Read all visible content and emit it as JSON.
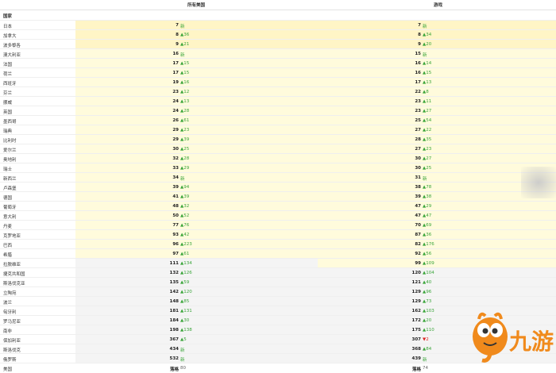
{
  "header": {
    "col1": "所有美国",
    "col2": "游戏"
  },
  "section": "国家",
  "rows": [
    {
      "name": "日本",
      "r1": "7",
      "c1": "新",
      "r2": "7",
      "c2": "新"
    },
    {
      "name": "加拿大",
      "r1": "8",
      "c1": "▲36",
      "r2": "8",
      "c2": "▲34"
    },
    {
      "name": "波多黎各",
      "r1": "9",
      "c1": "▲21",
      "r2": "9",
      "c2": "▲20"
    },
    {
      "name": "澳大利亚",
      "r1": "16",
      "c1": "新",
      "r2": "15",
      "c2": "新"
    },
    {
      "name": "法国",
      "r1": "17",
      "c1": "▲15",
      "r2": "16",
      "c2": "▲14"
    },
    {
      "name": "荷兰",
      "r1": "17",
      "c1": "▲15",
      "r2": "16",
      "c2": "▲15"
    },
    {
      "name": "西班牙",
      "r1": "19",
      "c1": "▲16",
      "r2": "17",
      "c2": "▲13"
    },
    {
      "name": "芬兰",
      "r1": "23",
      "c1": "▲12",
      "r2": "22",
      "c2": "▲8"
    },
    {
      "name": "挪威",
      "r1": "24",
      "c1": "▲13",
      "r2": "23",
      "c2": "▲11"
    },
    {
      "name": "英国",
      "r1": "24",
      "c1": "▲28",
      "r2": "23",
      "c2": "▲27"
    },
    {
      "name": "墨西哥",
      "r1": "26",
      "c1": "▲61",
      "r2": "25",
      "c2": "▲54"
    },
    {
      "name": "瑞典",
      "r1": "29",
      "c1": "▲23",
      "r2": "27",
      "c2": "▲22"
    },
    {
      "name": "比利时",
      "r1": "29",
      "c1": "▲39",
      "r2": "28",
      "c2": "▲35"
    },
    {
      "name": "爱尔兰",
      "r1": "30",
      "c1": "▲25",
      "r2": "27",
      "c2": "▲23"
    },
    {
      "name": "奥地利",
      "r1": "32",
      "c1": "▲28",
      "r2": "30",
      "c2": "▲27"
    },
    {
      "name": "瑞士",
      "r1": "33",
      "c1": "▲29",
      "r2": "30",
      "c2": "▲25"
    },
    {
      "name": "新西兰",
      "r1": "34",
      "c1": "新",
      "r2": "31",
      "c2": "新"
    },
    {
      "name": "卢森堡",
      "r1": "39",
      "c1": "▲94",
      "r2": "38",
      "c2": "▲78"
    },
    {
      "name": "德国",
      "r1": "41",
      "c1": "▲39",
      "r2": "39",
      "c2": "▲38"
    },
    {
      "name": "葡萄牙",
      "r1": "48",
      "c1": "▲32",
      "r2": "47",
      "c2": "▲29"
    },
    {
      "name": "意大利",
      "r1": "50",
      "c1": "▲52",
      "r2": "47",
      "c2": "▲47"
    },
    {
      "name": "丹麦",
      "r1": "77",
      "c1": "▲76",
      "r2": "70",
      "c2": "▲69"
    },
    {
      "name": "克罗地亚",
      "r1": "93",
      "c1": "▲42",
      "r2": "87",
      "c2": "▲36"
    },
    {
      "name": "巴西",
      "r1": "96",
      "c1": "▲223",
      "r2": "82",
      "c2": "▲176"
    },
    {
      "name": "希腊",
      "r1": "97",
      "c1": "▲61",
      "r2": "92",
      "c2": "▲56"
    },
    {
      "name": "拉脱维亚",
      "r1": "111",
      "c1": "▲134",
      "r2": "99",
      "c2": "▲109"
    },
    {
      "name": "捷克共和国",
      "r1": "132",
      "c1": "▲126",
      "r2": "120",
      "c2": "▲104"
    },
    {
      "name": "斯洛伐克亚",
      "r1": "135",
      "c1": "▲59",
      "r2": "121",
      "c2": "▲40"
    },
    {
      "name": "立陶宛",
      "r1": "142",
      "c1": "▲120",
      "r2": "129",
      "c2": "▲96"
    },
    {
      "name": "波兰",
      "r1": "148",
      "c1": "▲85",
      "r2": "129",
      "c2": "▲73"
    },
    {
      "name": "匈牙利",
      "r1": "181",
      "c1": "▲131",
      "r2": "162",
      "c2": "▲103"
    },
    {
      "name": "罗马尼亚",
      "r1": "184",
      "c1": "▲30",
      "r2": "172",
      "c2": "▲20"
    },
    {
      "name": "南非",
      "r1": "198",
      "c1": "▲138",
      "r2": "175",
      "c2": "▲110"
    },
    {
      "name": "保加利亚",
      "r1": "367",
      "c1": "▲5",
      "r2": "307",
      "c2": "▼2"
    },
    {
      "name": "斯洛伐克",
      "r1": "434",
      "c1": "新",
      "r2": "368",
      "c2": "▲84"
    },
    {
      "name": "俄罗斯",
      "r1": "532",
      "c1": "新",
      "r2": "439",
      "c2": "新"
    },
    {
      "name": "美国",
      "r1": "落格",
      "c1": "80",
      "r2": "落格",
      "c2": "74"
    }
  ],
  "logo": {
    "text": "九游",
    "colors": {
      "orange": "#f08a1c",
      "dark": "#333333"
    }
  }
}
